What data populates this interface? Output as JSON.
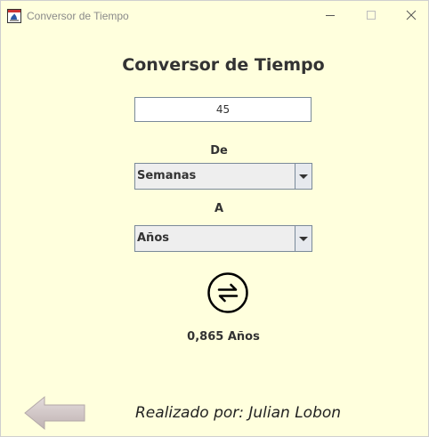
{
  "window": {
    "title": "Conversor de Tiempo",
    "background_color": "#ffffdd"
  },
  "main": {
    "heading": "Conversor de Tiempo",
    "input_value": "45",
    "from_label": "De",
    "from_selected": "Semanas",
    "to_label": "A",
    "to_selected": "Años",
    "result": "0,865 Años",
    "credits": "Realizado por: Julian Lobon"
  },
  "icons": {
    "convert": "swap-arrows-icon",
    "back": "left-arrow-icon"
  }
}
